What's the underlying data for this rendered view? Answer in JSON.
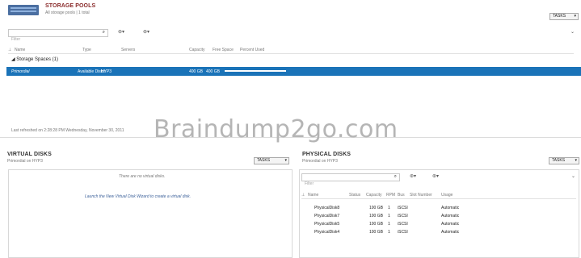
{
  "storage_pools": {
    "title": "STORAGE POOLS",
    "subtitle": "All storage pools | 1 total",
    "tasks_label": "TASKS",
    "filter_placeholder": "Filter",
    "columns": [
      "Name",
      "Type",
      "Servers",
      "Capacity",
      "Free Space",
      "Percent Used"
    ],
    "group_label": "Storage Spaces (1)",
    "rows": [
      {
        "name": "Primordial",
        "type": "Available Disks",
        "servers": "HYP3",
        "capacity": "400 GB",
        "free_space": "400 GB",
        "percent_used": 0.95
      }
    ],
    "status": "Last refreshed on 2:28:28 PM Wednesday, November 30, 2011"
  },
  "watermark": "Braindump2go.com",
  "virtual_disks": {
    "title": "VIRTUAL DISKS",
    "subtitle": "Primordial on HYP3",
    "tasks_label": "TASKS",
    "empty_message": "There are no virtual disks.",
    "launch_link": "Launch the New Virtual Disk Wizard to create a virtual disk."
  },
  "physical_disks": {
    "title": "PHYSICAL DISKS",
    "subtitle": "Primordial on HYP3",
    "tasks_label": "TASKS",
    "filter_placeholder": "Filter",
    "columns": [
      "Name",
      "Status",
      "Capacity",
      "RPM",
      "Bus",
      "Slot Number",
      "Usage"
    ],
    "rows": [
      {
        "name": "PhysicalDisk8",
        "status": "",
        "capacity": "100 GB",
        "rpm": "1",
        "bus": "iSCSI",
        "slot": "",
        "usage": "Automatic"
      },
      {
        "name": "PhysicalDisk7",
        "status": "",
        "capacity": "100 GB",
        "rpm": "1",
        "bus": "iSCSI",
        "slot": "",
        "usage": "Automatic"
      },
      {
        "name": "PhysicalDisk5",
        "status": "",
        "capacity": "100 GB",
        "rpm": "1",
        "bus": "iSCSI",
        "slot": "",
        "usage": "Automatic"
      },
      {
        "name": "PhysicalDisk4",
        "status": "",
        "capacity": "100 GB",
        "rpm": "1",
        "bus": "iSCSI",
        "slot": "",
        "usage": "Automatic"
      }
    ]
  },
  "icons": [
    "storage-pool-icon",
    "search-icon",
    "filter-icon",
    "group-icon",
    "chevron-down-icon",
    "expand-icon",
    "sort-icon",
    "collapse-triangle-icon"
  ],
  "colors": {
    "selection": "#1a73b8",
    "title_text": "#1f3e6e",
    "watermark": "#b5b5b5"
  }
}
